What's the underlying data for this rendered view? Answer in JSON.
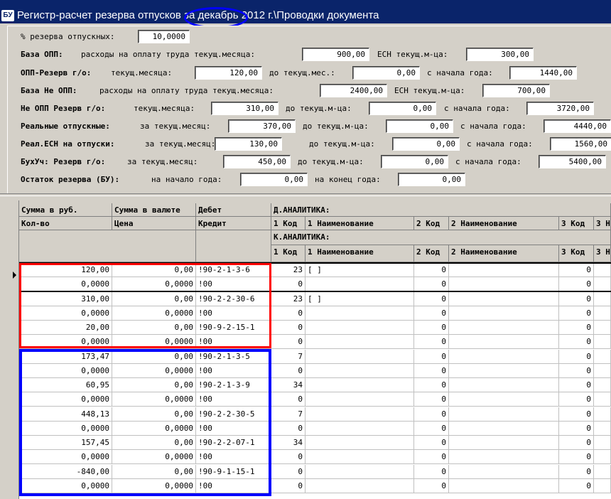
{
  "window": {
    "icon_text": "БУ",
    "title_prefix": "Регистр-расчет резерва отпусков ",
    "title_period": "за декабрь",
    "title_suffix": " 2012 г.\\Проводки документа"
  },
  "form": {
    "reserve_pct": {
      "label": "% резерва отпускных:",
      "value": "10,0000"
    },
    "base_opp": {
      "label": "База ОПП:",
      "desc": "расходы на  оплату труда текущ.месяца:",
      "value": "900,00",
      "esn_label": "ЕСН текущ.м-ца:",
      "esn_value": "300,00"
    },
    "opp_reserve": {
      "label": "ОПП-Резерв г/о:",
      "l1": "текущ.месяца:",
      "v1": "120,00",
      "l2": "до текущ.мес.:",
      "v2": "0,00",
      "l3": "с начала года:",
      "v3": "1440,00"
    },
    "base_ne_opp": {
      "label": "База Не ОПП:",
      "desc": "расходы на  оплату труда текущ.месяца:",
      "value": "2400,00",
      "esn_label": "ЕСН текущ.м-ца:",
      "esn_value": "700,00"
    },
    "ne_opp_reserve": {
      "label": "Не ОПП Резерв г/о:",
      "l1": "текущ.месяца:",
      "v1": "310,00",
      "l2": "до текущ.м-ца:",
      "v2": "0,00",
      "l3": "с начала года:",
      "v3": "3720,00"
    },
    "real_vac": {
      "label": "Реальные отпускные:",
      "l1": "за текущ.месяц:",
      "v1": "370,00",
      "l2": "до текущ.м-ца:",
      "v2": "0,00",
      "l3": "с начала года:",
      "v3": "4440,00"
    },
    "real_esn": {
      "label": "Реал.ЕСН на отпуски:",
      "l1": "за текущ.месяц:",
      "v1": "130,00",
      "l2": "до текущ.м-ца:",
      "v2": "0,00",
      "l3": "с начала года:",
      "v3": "1560,00"
    },
    "buh_reserve": {
      "label": "БухУч: Резерв г/о:",
      "l1": "за текущ.месяц:",
      "v1": "450,00",
      "l2": "до текущ.м-ца:",
      "v2": "0,00",
      "l3": "с начала года:",
      "v3": "5400,00"
    },
    "balance": {
      "label": "Остаток резерва (БУ):",
      "l1": "на начало года:",
      "v1": "0,00",
      "l2": "на конец года:",
      "v2": "0,00"
    }
  },
  "grid": {
    "headers": {
      "sum_rub": "Сумма в руб.",
      "qty": "Кол-во",
      "sum_cur": "Сумма в валюте",
      "price": "Цена",
      "debit": "Дебет",
      "credit": "Кредит",
      "d_analytics": "Д.АНАЛИТИКА:",
      "k_analytics": "К.АНАЛИТИКА:",
      "code1": "1 Код",
      "name1": "1 Наименование",
      "code2": "2 Код",
      "name2": "2 Наименование",
      "code3": "3 Код",
      "name3": "3 Н"
    },
    "rows": [
      {
        "a": "120,00",
        "b": "0,00",
        "c": "!90-2-1-3-6",
        "k1": "23",
        "n1": "[                    ]",
        "k2": "0",
        "k3": "0"
      },
      {
        "a": "0,0000",
        "b": "0,0000",
        "c": "!00",
        "k1": "0",
        "n1": "",
        "k2": "0",
        "k3": "0"
      },
      {
        "a": "310,00",
        "b": "0,00",
        "c": "!90-2-2-30-6",
        "k1": "23",
        "n1": "[                    ]",
        "k2": "0",
        "k3": "0"
      },
      {
        "a": "0,0000",
        "b": "0,0000",
        "c": "!00",
        "k1": "0",
        "n1": "",
        "k2": "0",
        "k3": "0"
      },
      {
        "a": "20,00",
        "b": "0,00",
        "c": "!90-9-2-15-1",
        "k1": "0",
        "n1": "",
        "k2": "0",
        "k3": "0"
      },
      {
        "a": "0,0000",
        "b": "0,0000",
        "c": "!00",
        "k1": "0",
        "n1": "",
        "k2": "0",
        "k3": "0"
      },
      {
        "a": "173,47",
        "b": "0,00",
        "c": "!90-2-1-3-5",
        "k1": "7",
        "n1": "",
        "k2": "0",
        "k3": "0"
      },
      {
        "a": "0,0000",
        "b": "0,0000",
        "c": "!00",
        "k1": "0",
        "n1": "",
        "k2": "0",
        "k3": "0"
      },
      {
        "a": "60,95",
        "b": "0,00",
        "c": "!90-2-1-3-9",
        "k1": "34",
        "n1": "",
        "k2": "0",
        "k3": "0"
      },
      {
        "a": "0,0000",
        "b": "0,0000",
        "c": "!00",
        "k1": "0",
        "n1": "",
        "k2": "0",
        "k3": "0"
      },
      {
        "a": "448,13",
        "b": "0,00",
        "c": "!90-2-2-30-5",
        "k1": "7",
        "n1": "",
        "k2": "0",
        "k3": "0"
      },
      {
        "a": "0,0000",
        "b": "0,0000",
        "c": "!00",
        "k1": "0",
        "n1": "",
        "k2": "0",
        "k3": "0"
      },
      {
        "a": "157,45",
        "b": "0,00",
        "c": "!90-2-2-07-1",
        "k1": "34",
        "n1": "",
        "k2": "0",
        "k3": "0"
      },
      {
        "a": "0,0000",
        "b": "0,0000",
        "c": "!00",
        "k1": "0",
        "n1": "",
        "k2": "0",
        "k3": "0"
      },
      {
        "a": "-840,00",
        "b": "0,00",
        "c": "!90-9-1-15-1",
        "k1": "0",
        "n1": "",
        "k2": "0",
        "k3": "0"
      },
      {
        "a": "0,0000",
        "b": "0,0000",
        "c": "!00",
        "k1": "0",
        "n1": "",
        "k2": "0",
        "k3": "0"
      }
    ]
  }
}
